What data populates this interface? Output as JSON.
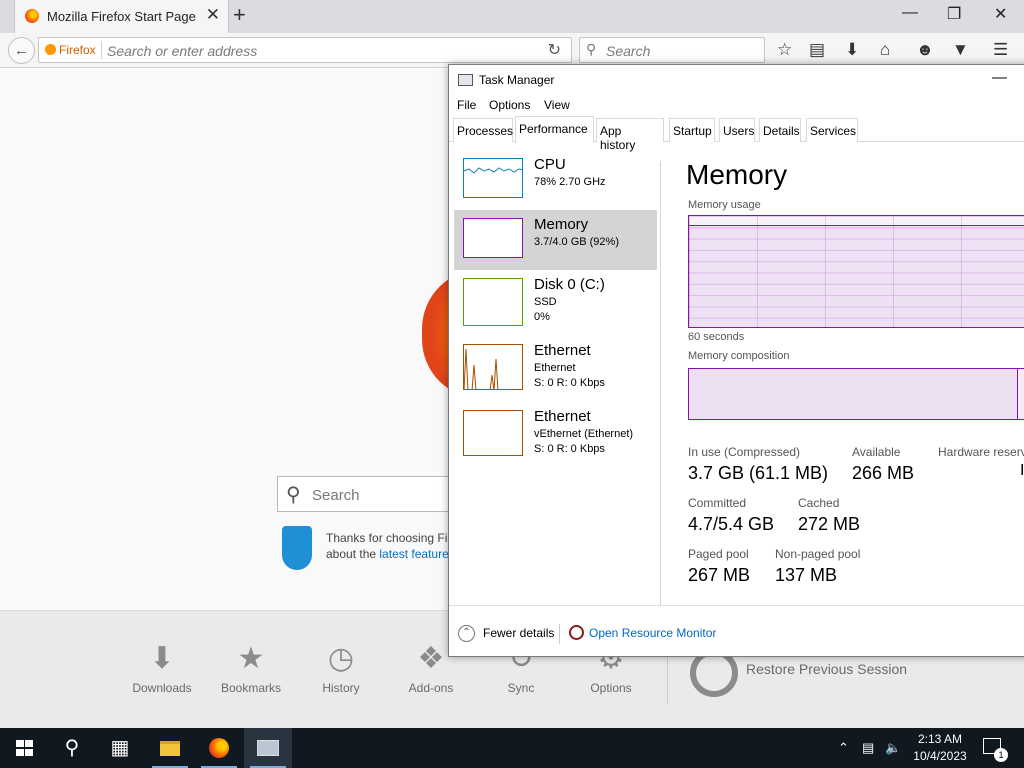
{
  "firefox": {
    "tab_title": "Mozilla Firefox Start Page",
    "tab_close": "✕",
    "new_tab": "+",
    "window_minimize": "—",
    "window_restore": "❐",
    "window_close": "✕",
    "identity_label": "Firefox",
    "url_placeholder": "Search or enter address",
    "search_placeholder": "Search",
    "home_search_placeholder": "Search",
    "snippet_line1": "Thanks for choosing Fir",
    "snippet_line2_prefix": "about the ",
    "snippet_link": "latest feature",
    "launcher": [
      {
        "label": "Downloads",
        "icon": "download-icon"
      },
      {
        "label": "Bookmarks",
        "icon": "star-icon"
      },
      {
        "label": "History",
        "icon": "clock-icon"
      },
      {
        "label": "Add-ons",
        "icon": "puzzle-icon"
      },
      {
        "label": "Sync",
        "icon": "sync-icon"
      },
      {
        "label": "Options",
        "icon": "gear-icon"
      }
    ],
    "restore_session": "Restore Previous Session"
  },
  "task_manager": {
    "title": "Task Manager",
    "minimize": "—",
    "menu": [
      "File",
      "Options",
      "View"
    ],
    "tabs": [
      "Processes",
      "Performance",
      "App history",
      "Startup",
      "Users",
      "Details",
      "Services"
    ],
    "active_tab": "Performance",
    "resources": [
      {
        "name": "CPU",
        "line1": "78%  2.70 GHz",
        "line2": "",
        "color": "#117dbb"
      },
      {
        "name": "Memory",
        "line1": "3.7/4.0 GB (92%)",
        "line2": "",
        "color": "#8b12ae"
      },
      {
        "name": "Disk 0 (C:)",
        "line1": "SSD",
        "line2": "0%",
        "color": "#4da60c"
      },
      {
        "name": "Ethernet",
        "line1": "Ethernet",
        "line2": "S: 0  R: 0 Kbps",
        "color": "#a74f01"
      },
      {
        "name": "Ethernet",
        "line1": "vEthernet (Ethernet)",
        "line2": "S: 0  R: 0 Kbps",
        "color": "#a74f01"
      }
    ],
    "selected_resource": "Memory",
    "main_title": "Memory",
    "usage_label": "Memory usage",
    "usage_fraction": 0.92,
    "time_label": "60 seconds",
    "composition_label": "Memory composition",
    "composition_in_use_fraction": 0.92,
    "stats": {
      "in_use_label": "In use (Compressed)",
      "in_use_value": "3.7 GB (61.1 MB)",
      "available_label": "Available",
      "available_value": "266 MB",
      "hardware_reserved_label": "Hardware reserve",
      "committed_label": "Committed",
      "committed_value": "4.7/5.4 GB",
      "cached_label": "Cached",
      "cached_value": "272 MB",
      "paged_pool_label": "Paged pool",
      "paged_pool_value": "267 MB",
      "nonpaged_pool_label": "Non-paged pool",
      "nonpaged_pool_value": "137 MB"
    },
    "fewer_details": "Fewer details",
    "open_resource_monitor": "Open Resource Monitor"
  },
  "taskbar": {
    "time": "2:13 AM",
    "date": "10/4/2023",
    "notification_count": "1"
  },
  "colors": {
    "memory": "#8b12ae",
    "cpu": "#117dbb",
    "disk": "#4da60c",
    "ethernet": "#a74f01",
    "taskbar": "#101820"
  }
}
